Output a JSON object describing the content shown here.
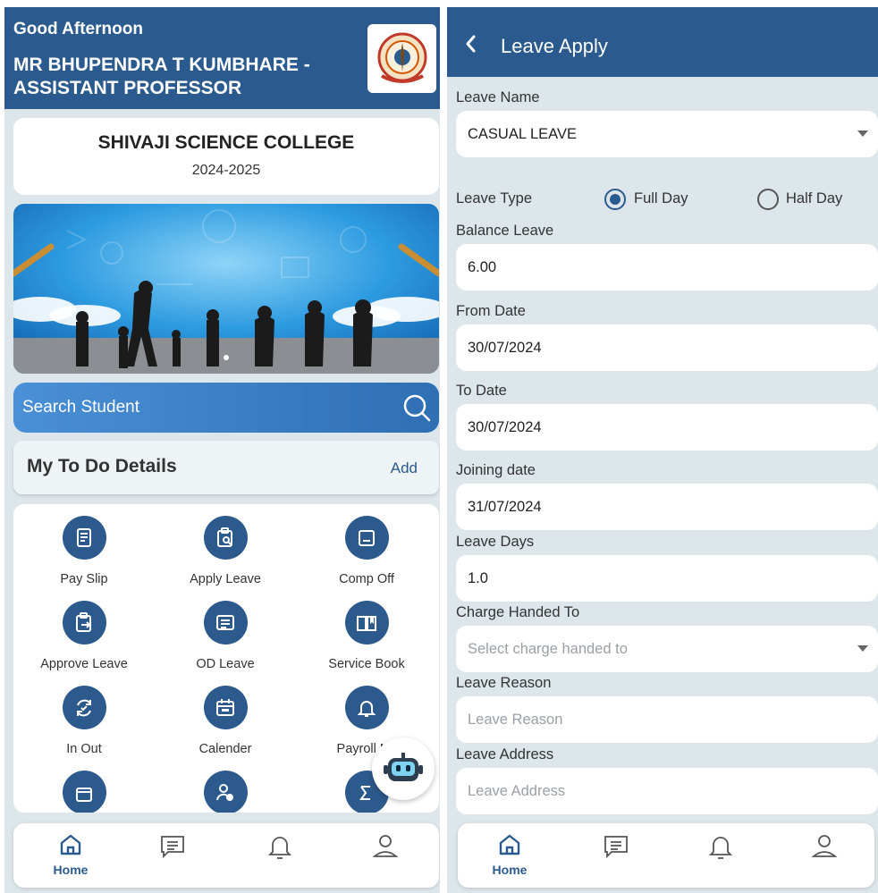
{
  "home": {
    "greeting": "Good Afternoon",
    "user_name": "MR BHUPENDRA T KUMBHARE - ASSISTANT PROFESSOR",
    "college_name": "SHIVAJI SCIENCE COLLEGE",
    "academic_year": "2024-2025",
    "search_placeholder": "Search Student",
    "todo_title": "My To Do Details",
    "todo_add": "Add",
    "tiles": [
      {
        "label": "Pay Slip",
        "icon": "pay-slip-icon"
      },
      {
        "label": "Apply Leave",
        "icon": "apply-leave-icon"
      },
      {
        "label": "Comp Off",
        "icon": "comp-off-icon"
      },
      {
        "label": "Approve Leave",
        "icon": "approve-leave-icon"
      },
      {
        "label": "OD Leave",
        "icon": "od-leave-icon"
      },
      {
        "label": "Service Book",
        "icon": "service-book-icon"
      },
      {
        "label": "In Out",
        "icon": "in-out-icon"
      },
      {
        "label": "Calender",
        "icon": "calendar-icon"
      },
      {
        "label": "Payroll No",
        "icon": "payroll-bell-icon"
      }
    ]
  },
  "nav": {
    "home_label": "Home",
    "items": [
      "home-icon",
      "message-icon",
      "bell-icon",
      "profile-icon"
    ],
    "active_color": "#2b5b8e"
  },
  "leave": {
    "title": "Leave Apply",
    "leave_name_label": "Leave Name",
    "leave_name_value": "CASUAL LEAVE",
    "leave_type_label": "Leave Type",
    "leave_type_options": [
      "Full Day",
      "Half Day"
    ],
    "leave_type_selected": "Full Day",
    "balance_label": "Balance Leave",
    "balance_value": "6.00",
    "from_label": "From Date",
    "from_value": "30/07/2024",
    "to_label": "To Date",
    "to_value": "30/07/2024",
    "joining_label": "Joining date",
    "joining_value": "31/07/2024",
    "days_label": "Leave Days",
    "days_value": "1.0",
    "charge_label": "Charge Handed To",
    "charge_placeholder": "Select charge handed to",
    "reason_label": "Leave Reason",
    "reason_placeholder": "Leave Reason",
    "address_label": "Leave Address",
    "address_placeholder": "Leave Address"
  },
  "colors": {
    "primary": "#2b5b8e",
    "background": "#dde6ea"
  }
}
